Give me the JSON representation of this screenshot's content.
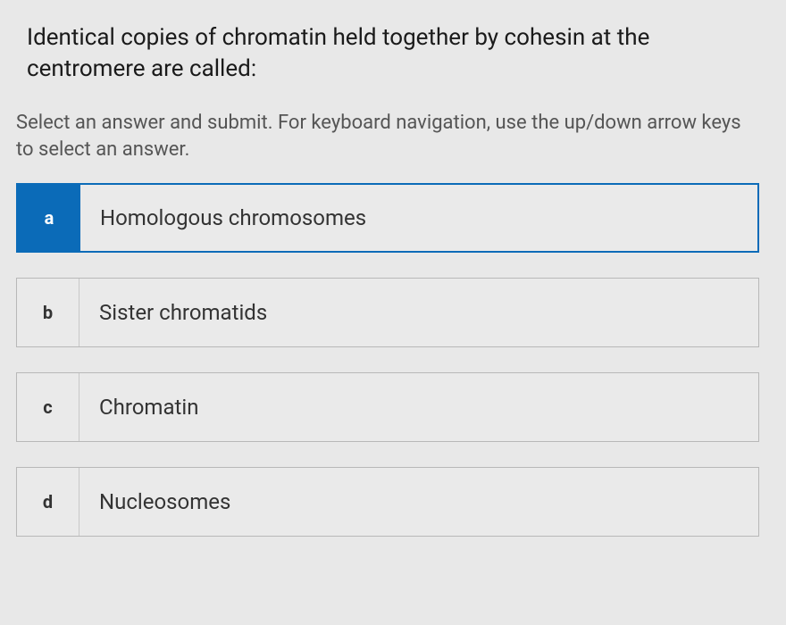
{
  "question": "Identical copies of chromatin held together by cohesin at the centromere are called:",
  "instruction": "Select an answer and submit. For keyboard navigation, use the up/down arrow keys to select an answer.",
  "options": [
    {
      "letter": "a",
      "text": "Homologous chromosomes",
      "selected": true
    },
    {
      "letter": "b",
      "text": "Sister chromatids",
      "selected": false
    },
    {
      "letter": "c",
      "text": "Chromatin",
      "selected": false
    },
    {
      "letter": "d",
      "text": "Nucleosomes",
      "selected": false
    }
  ]
}
